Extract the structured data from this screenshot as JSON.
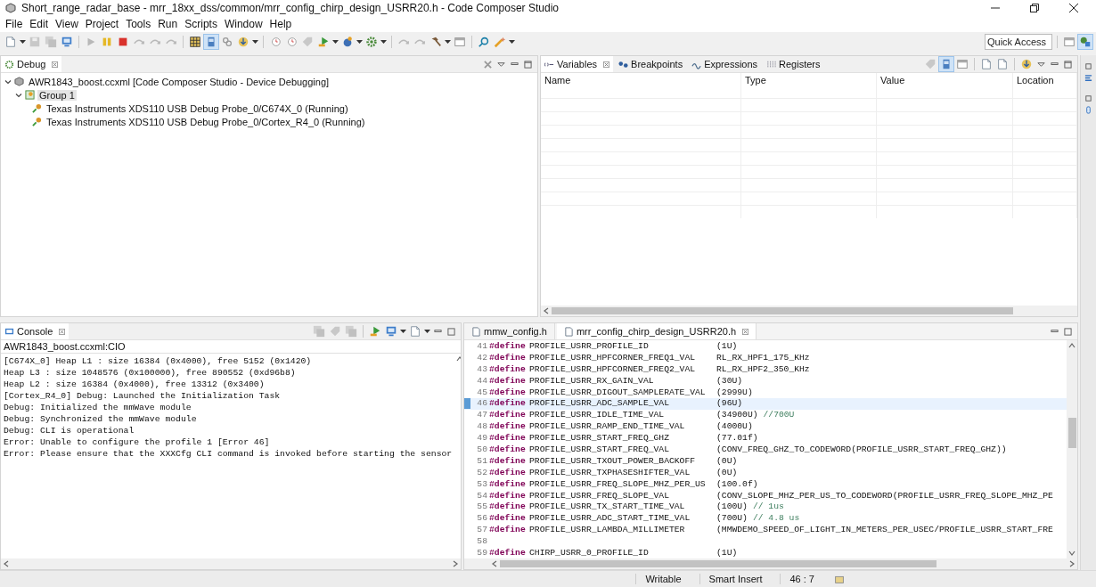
{
  "window": {
    "title": "Short_range_radar_base - mrr_18xx_dss/common/mrr_config_chirp_design_USRR20.h - Code Composer Studio"
  },
  "menu": [
    "File",
    "Edit",
    "View",
    "Project",
    "Tools",
    "Run",
    "Scripts",
    "Window",
    "Help"
  ],
  "quick_access": {
    "placeholder": "Quick Access"
  },
  "debug_view": {
    "tab": "Debug",
    "tree": [
      {
        "label": "AWR1843_boost.ccxml [Code Composer Studio - Device Debugging]",
        "expanded": true,
        "selected": false,
        "children": [
          {
            "label": "Group 1",
            "expanded": true,
            "selected": true,
            "children": [
              {
                "label": "Texas Instruments XDS110 USB Debug Probe_0/C674X_0 (Running)",
                "selected": false
              },
              {
                "label": "Texas Instruments XDS110 USB Debug Probe_0/Cortex_R4_0 (Running)",
                "selected": false
              }
            ]
          }
        ]
      }
    ]
  },
  "variables_view": {
    "tabs": [
      {
        "label": "Variables",
        "selected": true
      },
      {
        "label": "Breakpoints",
        "selected": false
      },
      {
        "label": "Expressions",
        "selected": false
      },
      {
        "label": "Registers",
        "selected": false
      }
    ],
    "columns": [
      "Name",
      "Type",
      "Value",
      "Location"
    ]
  },
  "console": {
    "tab": "Console",
    "subtitle": "AWR1843_boost.ccxml:CIO",
    "lines": [
      "[C674X_0] Heap L1 : size 16384 (0x4000), free 5152 (0x1420)",
      "Heap L3 : size 1048576 (0x100000), free 890552 (0xd96b8)",
      "Heap L2 : size 16384 (0x4000), free 13312 (0x3400)",
      "[Cortex_R4_0] Debug: Launched the Initialization Task",
      "Debug: Initialized the mmWave module",
      "Debug: Synchronized the mmWave module",
      "Debug: CLI is operational",
      "Error: Unable to configure the profile 1 [Error 46]",
      "Error: Please ensure that the XXXCfg CLI command is invoked before starting the sensor"
    ]
  },
  "editor": {
    "tabs": [
      {
        "label": "mmw_config.h",
        "selected": false
      },
      {
        "label": "mrr_config_chirp_design_USRR20.h",
        "selected": true
      }
    ],
    "lines": [
      {
        "number": "41",
        "keyword": "#define",
        "name": "PROFILE_USRR_PROFILE_ID",
        "value": "(1U)",
        "current": false
      },
      {
        "number": "42",
        "keyword": "#define",
        "name": "PROFILE_USRR_HPFCORNER_FREQ1_VAL",
        "value": "RL_RX_HPF1_175_KHz",
        "current": false
      },
      {
        "number": "43",
        "keyword": "#define",
        "name": "PROFILE_USRR_HPFCORNER_FREQ2_VAL",
        "value": "RL_RX_HPF2_350_KHz",
        "current": false
      },
      {
        "number": "44",
        "keyword": "#define",
        "name": "PROFILE_USRR_RX_GAIN_VAL",
        "value": "(30U)",
        "current": false
      },
      {
        "number": "45",
        "keyword": "#define",
        "name": "PROFILE_USRR_DIGOUT_SAMPLERATE_VAL",
        "value": "(2999U)",
        "current": false
      },
      {
        "number": "46",
        "keyword": "#define",
        "name": "PROFILE_USRR_ADC_SAMPLE_VAL",
        "value": "(96U)",
        "current": true
      },
      {
        "number": "47",
        "keyword": "#define",
        "name": "PROFILE_USRR_IDLE_TIME_VAL",
        "value": "(34900U)",
        "comment": "//700U",
        "current": false
      },
      {
        "number": "48",
        "keyword": "#define",
        "name": "PROFILE_USRR_RAMP_END_TIME_VAL",
        "value": "(4000U)",
        "current": false
      },
      {
        "number": "49",
        "keyword": "#define",
        "name": "PROFILE_USRR_START_FREQ_GHZ",
        "value": "(77.01f)",
        "current": false
      },
      {
        "number": "50",
        "keyword": "#define",
        "name": "PROFILE_USRR_START_FREQ_VAL",
        "value": "(CONV_FREQ_GHZ_TO_CODEWORD(PROFILE_USRR_START_FREQ_GHZ))",
        "current": false
      },
      {
        "number": "51",
        "keyword": "#define",
        "name": "PROFILE_USRR_TXOUT_POWER_BACKOFF",
        "value": "(0U)",
        "current": false
      },
      {
        "number": "52",
        "keyword": "#define",
        "name": "PROFILE_USRR_TXPHASESHIFTER_VAL",
        "value": "(0U)",
        "current": false
      },
      {
        "number": "53",
        "keyword": "#define",
        "name": "PROFILE_USRR_FREQ_SLOPE_MHZ_PER_US",
        "value": "(100.0f)",
        "current": false
      },
      {
        "number": "54",
        "keyword": "#define",
        "name": "PROFILE_USRR_FREQ_SLOPE_VAL",
        "value": "(CONV_SLOPE_MHZ_PER_US_TO_CODEWORD(PROFILE_USRR_FREQ_SLOPE_MHZ_PE",
        "current": false
      },
      {
        "number": "55",
        "keyword": "#define",
        "name": "PROFILE_USRR_TX_START_TIME_VAL",
        "value": "(100U)",
        "comment": "// 1us",
        "current": false
      },
      {
        "number": "56",
        "keyword": "#define",
        "name": "PROFILE_USRR_ADC_START_TIME_VAL",
        "value": "(700U)",
        "comment": "// 4.8 us",
        "current": false
      },
      {
        "number": "57",
        "keyword": "#define",
        "name": "PROFILE_USRR_LAMBDA_MILLIMETER",
        "value": "(MMWDEMO_SPEED_OF_LIGHT_IN_METERS_PER_USEC/PROFILE_USRR_START_FRE",
        "current": false
      },
      {
        "number": "58",
        "current": false
      },
      {
        "number": "59",
        "keyword": "#define",
        "name": "CHIRP_USRR_0_PROFILE_ID",
        "value": "(1U)",
        "current": false
      }
    ]
  },
  "status_bar": [
    "Writable",
    "Smart Insert",
    "46 : 7"
  ]
}
